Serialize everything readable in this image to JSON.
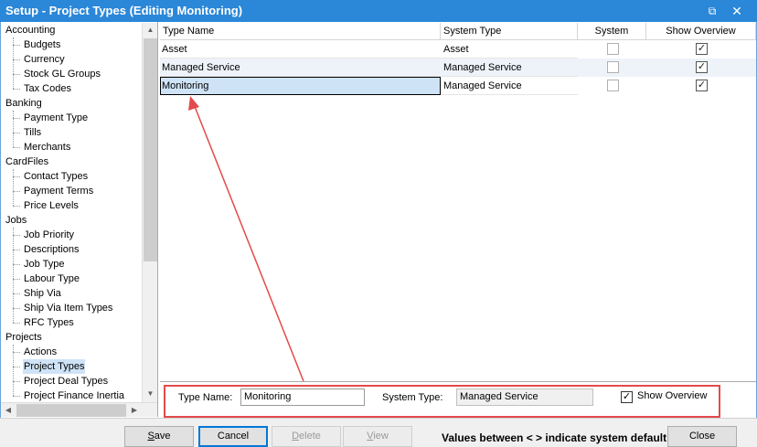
{
  "window": {
    "title": "Setup - Project Types (Editing Monitoring)",
    "restore_glyph": "⧉",
    "close_glyph": "✕"
  },
  "tree": [
    {
      "label": "Accounting",
      "children": [
        "Budgets",
        "Currency",
        "Stock GL Groups",
        "Tax Codes"
      ]
    },
    {
      "label": "Banking",
      "children": [
        "Payment Type",
        "Tills",
        "Merchants"
      ]
    },
    {
      "label": "CardFiles",
      "children": [
        "Contact Types",
        "Payment Terms",
        "Price Levels"
      ]
    },
    {
      "label": "Jobs",
      "children": [
        "Job Priority",
        "Descriptions",
        "Job Type",
        "Labour Type",
        "Ship Via",
        "Ship Via Item Types",
        "RFC Types"
      ]
    },
    {
      "label": "Projects",
      "children": [
        "Actions",
        "Project Types",
        "Project Deal Types",
        "Project Finance Inertia"
      ]
    }
  ],
  "tree_selected": "Project Types",
  "grid": {
    "columns": [
      "Type Name",
      "System Type",
      "System",
      "Show Overview"
    ],
    "rows": [
      {
        "type_name": "Asset",
        "system_type": "Asset",
        "system": false,
        "show_overview": true
      },
      {
        "type_name": "Managed Service",
        "system_type": "Managed Service",
        "system": false,
        "show_overview": true
      },
      {
        "type_name": "Monitoring",
        "system_type": "Managed Service",
        "system": false,
        "show_overview": true
      }
    ],
    "editing_row": 2
  },
  "detail": {
    "type_name_label": "Type Name:",
    "type_name_value": "Monitoring",
    "system_type_label": "System Type:",
    "system_type_value": "Managed Service",
    "show_overview_label": "Show Overview",
    "show_overview_checked": true
  },
  "buttons": {
    "save": {
      "label": "Save",
      "accel": "S",
      "rest": "ave"
    },
    "cancel": {
      "label": "Cancel"
    },
    "delete": {
      "label": "Delete",
      "accel": "D",
      "rest": "elete"
    },
    "view": {
      "label": "View",
      "accel": "V",
      "rest": "iew"
    },
    "close": {
      "label": "Close"
    }
  },
  "note": "Values between < > indicate system default",
  "colors": {
    "titlebar": "#2b87d8",
    "annotation": "#e24b4b",
    "selection": "#cfe3f7"
  }
}
